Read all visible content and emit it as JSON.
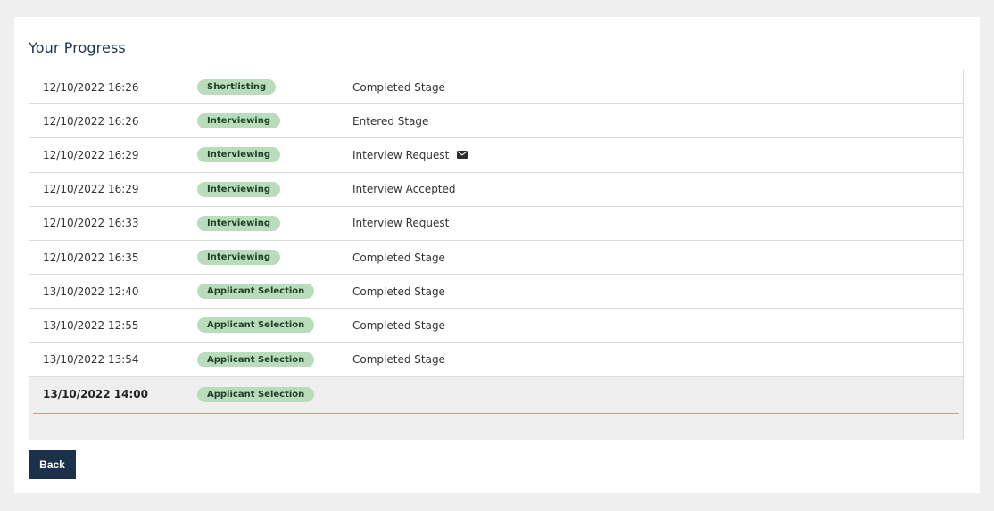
{
  "page": {
    "title": "Your Progress",
    "back_label": "Back"
  },
  "colors": {
    "pill_bg": "#b8dcbc",
    "pill_text": "#1f3f26",
    "button_bg": "#1b3149",
    "current_rule": "#6fcf7f"
  },
  "rows": [
    {
      "date": "12/10/2022 16:26",
      "stage": "Shortlisting",
      "event": "Completed Stage",
      "icon": ""
    },
    {
      "date": "12/10/2022 16:26",
      "stage": "Interviewing",
      "event": "Entered Stage",
      "icon": ""
    },
    {
      "date": "12/10/2022 16:29",
      "stage": "Interviewing",
      "event": "Interview Request",
      "icon": "envelope-icon"
    },
    {
      "date": "12/10/2022 16:29",
      "stage": "Interviewing",
      "event": "Interview Accepted",
      "icon": ""
    },
    {
      "date": "12/10/2022 16:33",
      "stage": "Interviewing",
      "event": "Interview Request",
      "icon": ""
    },
    {
      "date": "12/10/2022 16:35",
      "stage": "Interviewing",
      "event": "Completed Stage",
      "icon": ""
    },
    {
      "date": "13/10/2022 12:40",
      "stage": "Applicant Selection",
      "event": "Completed Stage",
      "icon": ""
    },
    {
      "date": "13/10/2022 12:55",
      "stage": "Applicant Selection",
      "event": "Completed Stage",
      "icon": ""
    },
    {
      "date": "13/10/2022 13:54",
      "stage": "Applicant Selection",
      "event": "Completed Stage",
      "icon": ""
    }
  ],
  "current": {
    "date": "13/10/2022 14:00",
    "stage": "Applicant Selection"
  }
}
